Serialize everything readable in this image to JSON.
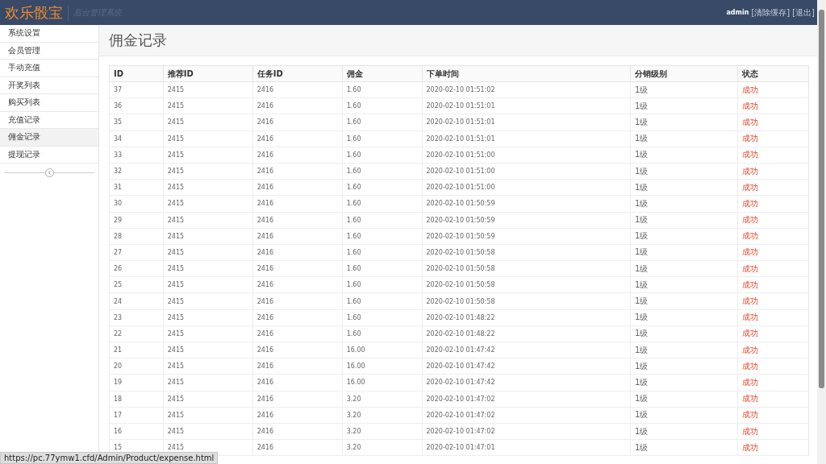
{
  "header": {
    "logo": "欢乐骰宝",
    "subtitle": "后台管理系统",
    "user": "admin",
    "links": [
      "[清除缓存]",
      "[退出]"
    ]
  },
  "sidebar": {
    "items": [
      {
        "label": "系统设置",
        "selected": false
      },
      {
        "label": "会员管理",
        "selected": false
      },
      {
        "label": "手动充值",
        "selected": false
      },
      {
        "label": "开奖列表",
        "selected": false
      },
      {
        "label": "购买列表",
        "selected": false
      },
      {
        "label": "充值记录",
        "selected": false
      },
      {
        "label": "佣金记录",
        "selected": true
      },
      {
        "label": "提现记录",
        "selected": false
      }
    ]
  },
  "page_title": "佣金记录",
  "table": {
    "columns": [
      "ID",
      "推荐ID",
      "任务ID",
      "佣金",
      "下单时间",
      "分销级别",
      "状态"
    ],
    "rows": [
      [
        "37",
        "2415",
        "2416",
        "1.60",
        "2020-02-10 01:51:02",
        "1级",
        "成功"
      ],
      [
        "36",
        "2415",
        "2416",
        "1.60",
        "2020-02-10 01:51:01",
        "1级",
        "成功"
      ],
      [
        "35",
        "2415",
        "2416",
        "1.60",
        "2020-02-10 01:51:01",
        "1级",
        "成功"
      ],
      [
        "34",
        "2415",
        "2416",
        "1.60",
        "2020-02-10 01:51:01",
        "1级",
        "成功"
      ],
      [
        "33",
        "2415",
        "2416",
        "1.60",
        "2020-02-10 01:51:00",
        "1级",
        "成功"
      ],
      [
        "32",
        "2415",
        "2416",
        "1.60",
        "2020-02-10 01:51:00",
        "1级",
        "成功"
      ],
      [
        "31",
        "2415",
        "2416",
        "1.60",
        "2020-02-10 01:51:00",
        "1级",
        "成功"
      ],
      [
        "30",
        "2415",
        "2416",
        "1.60",
        "2020-02-10 01:50:59",
        "1级",
        "成功"
      ],
      [
        "29",
        "2415",
        "2416",
        "1.60",
        "2020-02-10 01:50:59",
        "1级",
        "成功"
      ],
      [
        "28",
        "2415",
        "2416",
        "1.60",
        "2020-02-10 01:50:59",
        "1级",
        "成功"
      ],
      [
        "27",
        "2415",
        "2416",
        "1.60",
        "2020-02-10 01:50:58",
        "1级",
        "成功"
      ],
      [
        "26",
        "2415",
        "2416",
        "1.60",
        "2020-02-10 01:50:58",
        "1级",
        "成功"
      ],
      [
        "25",
        "2415",
        "2416",
        "1.60",
        "2020-02-10 01:50:58",
        "1级",
        "成功"
      ],
      [
        "24",
        "2415",
        "2416",
        "1.60",
        "2020-02-10 01:50:58",
        "1级",
        "成功"
      ],
      [
        "23",
        "2415",
        "2416",
        "1.60",
        "2020-02-10 01:48:22",
        "1级",
        "成功"
      ],
      [
        "22",
        "2415",
        "2416",
        "1.60",
        "2020-02-10 01:48:22",
        "1级",
        "成功"
      ],
      [
        "21",
        "2415",
        "2416",
        "16.00",
        "2020-02-10 01:47:42",
        "1级",
        "成功"
      ],
      [
        "20",
        "2415",
        "2416",
        "16.00",
        "2020-02-10 01:47:42",
        "1级",
        "成功"
      ],
      [
        "19",
        "2415",
        "2416",
        "16.00",
        "2020-02-10 01:47:42",
        "1级",
        "成功"
      ],
      [
        "18",
        "2415",
        "2416",
        "3.20",
        "2020-02-10 01:47:02",
        "1级",
        "成功"
      ],
      [
        "17",
        "2415",
        "2416",
        "3.20",
        "2020-02-10 01:47:02",
        "1级",
        "成功"
      ],
      [
        "16",
        "2415",
        "2416",
        "3.20",
        "2020-02-10 01:47:02",
        "1级",
        "成功"
      ],
      [
        "15",
        "2415",
        "2416",
        "3.20",
        "2020-02-10 01:47:01",
        "1级",
        "成功"
      ]
    ]
  },
  "status_url": "https://pc.77ymw1.cfd/Admin/Product/expense.html"
}
